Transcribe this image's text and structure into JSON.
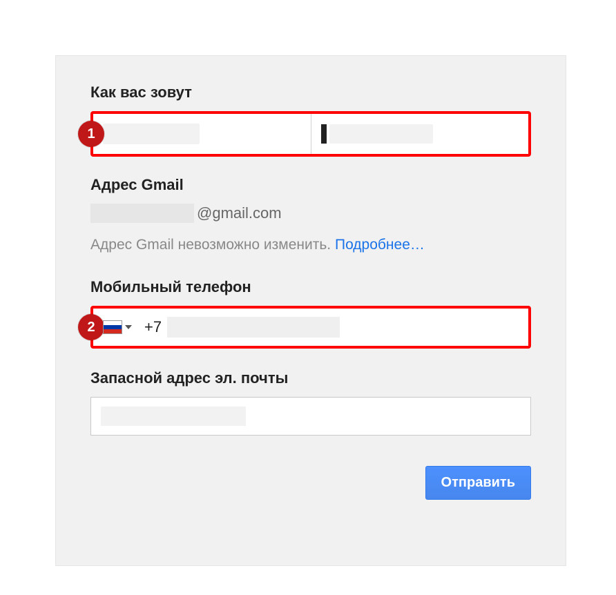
{
  "name_section": {
    "label": "Как вас зовут",
    "badge": "1"
  },
  "gmail_section": {
    "label": "Адрес Gmail",
    "domain_suffix": "@gmail.com",
    "note_text": "Адрес Gmail невозможно изменить. ",
    "note_link": "Подробнее…"
  },
  "phone_section": {
    "label": "Мобильный телефон",
    "badge": "2",
    "code": "+7"
  },
  "recovery_section": {
    "label": "Запасной адрес эл. почты"
  },
  "submit_label": "Отправить"
}
